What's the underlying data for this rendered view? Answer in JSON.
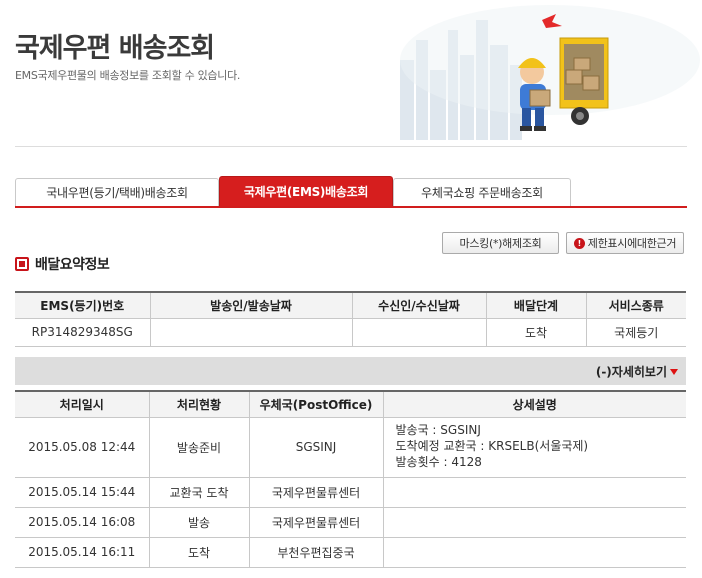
{
  "header": {
    "title": "국제우편 배송조회",
    "subtitle": "EMS국제우편물의 배송정보를 조회할 수 있습니다."
  },
  "tabs": [
    {
      "label": "국내우편(등기/택배)배송조회",
      "active": false
    },
    {
      "label": "국제우편(EMS)배송조회",
      "active": true
    },
    {
      "label": "우체국쇼핑 주문배송조회",
      "active": false
    }
  ],
  "buttons": {
    "masking": "마스킹(*)해제조회",
    "restriction": "제한표시에대한근거",
    "restriction_icon": "!"
  },
  "summary": {
    "title": "배달요약정보",
    "headers": [
      "EMS(등기)번호",
      "발송인/발송날짜",
      "수신인/수신날짜",
      "배달단계",
      "서비스종류"
    ],
    "row": [
      "RP314829348SG",
      "",
      "",
      "도착",
      "국제등기"
    ]
  },
  "detail_toggle": "(-)자세히보기",
  "detail": {
    "headers": [
      "처리일시",
      "처리현황",
      "우체국(PostOffice)",
      "상세설명"
    ],
    "rows": [
      {
        "datetime": "2015.05.08 12:44",
        "status": "발송준비",
        "office": "SGSINJ",
        "desc": [
          "발송국 : SGSINJ",
          "도착예정 교환국 : KRSELB(서울국제)",
          "발송횟수 : 4128"
        ]
      },
      {
        "datetime": "2015.05.14 15:44",
        "status": "교환국 도착",
        "office": "국제우편물류센터",
        "desc": []
      },
      {
        "datetime": "2015.05.14 16:08",
        "status": "발송",
        "office": "국제우편물류센터",
        "desc": []
      },
      {
        "datetime": "2015.05.14 16:11",
        "status": "도착",
        "office": "부천우편집중국",
        "desc": []
      }
    ]
  },
  "colors": {
    "accent": "#d61e1e",
    "header_bg": "#f3f3f3",
    "bar_bg": "#dddddd"
  }
}
